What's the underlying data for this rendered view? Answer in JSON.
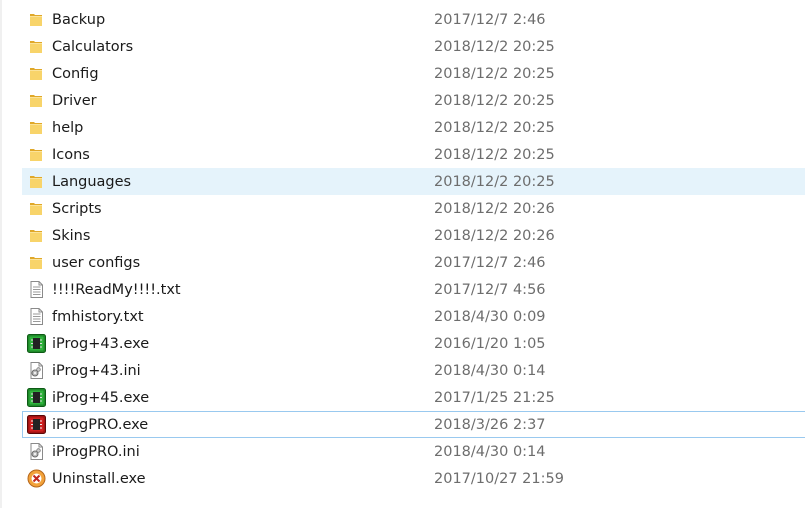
{
  "files": [
    {
      "name": "Backup",
      "date": "2017/12/7 2:46",
      "icon": "folder-icon"
    },
    {
      "name": "Calculators",
      "date": "2018/12/2 20:25",
      "icon": "folder-icon"
    },
    {
      "name": "Config",
      "date": "2018/12/2 20:25",
      "icon": "folder-icon"
    },
    {
      "name": "Driver",
      "date": "2018/12/2 20:25",
      "icon": "folder-icon"
    },
    {
      "name": "help",
      "date": "2018/12/2 20:25",
      "icon": "folder-icon"
    },
    {
      "name": "Icons",
      "date": "2018/12/2 20:25",
      "icon": "folder-icon"
    },
    {
      "name": "Languages",
      "date": "2018/12/2 20:25",
      "icon": "folder-icon",
      "selected": true
    },
    {
      "name": "Scripts",
      "date": "2018/12/2 20:26",
      "icon": "folder-icon"
    },
    {
      "name": "Skins",
      "date": "2018/12/2 20:26",
      "icon": "folder-icon"
    },
    {
      "name": "user configs",
      "date": "2017/12/7 2:46",
      "icon": "folder-icon"
    },
    {
      "name": "!!!!ReadMy!!!!.txt",
      "date": "2017/12/7 4:56",
      "icon": "text-file-icon"
    },
    {
      "name": "fmhistory.txt",
      "date": "2018/4/30 0:09",
      "icon": "text-file-icon"
    },
    {
      "name": "iProg+43.exe",
      "date": "2016/1/20 1:05",
      "icon": "chip-green-icon"
    },
    {
      "name": "iProg+43.ini",
      "date": "2018/4/30 0:14",
      "icon": "settings-file-icon"
    },
    {
      "name": "iProg+45.exe",
      "date": "2017/1/25 21:25",
      "icon": "chip-green-icon"
    },
    {
      "name": "iProgPRO.exe",
      "date": "2018/3/26 2:37",
      "icon": "chip-red-icon",
      "focused": true
    },
    {
      "name": "iProgPRO.ini",
      "date": "2018/4/30 0:14",
      "icon": "settings-file-icon"
    },
    {
      "name": "Uninstall.exe",
      "date": "2017/10/27 21:59",
      "icon": "uninstall-icon"
    }
  ],
  "colors": {
    "folder": "#f4c64c",
    "selection": "#e5f3fb",
    "focus_border": "#99c9ef",
    "date_text": "#6d6d6d"
  }
}
